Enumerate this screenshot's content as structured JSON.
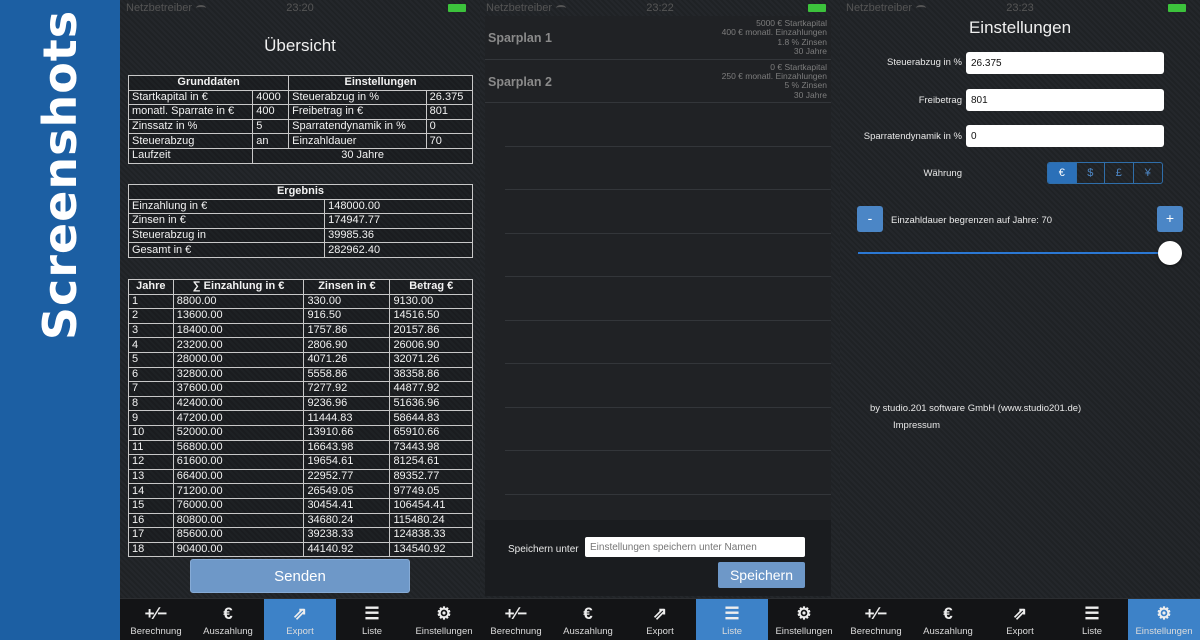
{
  "sidebar": {
    "title": "Screenshots"
  },
  "status": [
    {
      "carrier": "Netzbetreiber",
      "time": "23:20"
    },
    {
      "carrier": "Netzbetreiber",
      "time": "23:22"
    },
    {
      "carrier": "Netzbetreiber",
      "time": "23:23"
    }
  ],
  "overview": {
    "title": "Übersicht",
    "grund_header": "Grunddaten",
    "einst_header": "Einstellungen",
    "rows": [
      {
        "l1": "Startkapital in €",
        "v1": "4000",
        "l2": "Steuerabzug in %",
        "v2": "26.375"
      },
      {
        "l1": "monatl. Sparrate in €",
        "v1": "400",
        "l2": "Freibetrag in €",
        "v2": "801"
      },
      {
        "l1": "Zinssatz in %",
        "v1": "5",
        "l2": "Sparratendynamik in %",
        "v2": "0"
      },
      {
        "l1": "Steuerabzug",
        "v1": "an",
        "l2": "Einzahldauer",
        "v2": "70"
      }
    ],
    "laufzeit_label": "Laufzeit",
    "laufzeit_value": "30 Jahre",
    "ergebnis_header": "Ergebnis",
    "ergebnis": [
      {
        "label": "Einzahlung in €",
        "value": "148000.00"
      },
      {
        "label": "Zinsen in €",
        "value": "174947.77"
      },
      {
        "label": "Steuerabzug in",
        "value": "39985.36"
      },
      {
        "label": "Gesamt in €",
        "value": "282962.40"
      }
    ],
    "years_headers": [
      "Jahre",
      "∑ Einzahlung in €",
      "Zinsen in €",
      "Betrag €"
    ],
    "years": [
      [
        "1",
        "8800.00",
        "330.00",
        "9130.00"
      ],
      [
        "2",
        "13600.00",
        "916.50",
        "14516.50"
      ],
      [
        "3",
        "18400.00",
        "1757.86",
        "20157.86"
      ],
      [
        "4",
        "23200.00",
        "2806.90",
        "26006.90"
      ],
      [
        "5",
        "28000.00",
        "4071.26",
        "32071.26"
      ],
      [
        "6",
        "32800.00",
        "5558.86",
        "38358.86"
      ],
      [
        "7",
        "37600.00",
        "7277.92",
        "44877.92"
      ],
      [
        "8",
        "42400.00",
        "9236.96",
        "51636.96"
      ],
      [
        "9",
        "47200.00",
        "11444.83",
        "58644.83"
      ],
      [
        "10",
        "52000.00",
        "13910.66",
        "65910.66"
      ],
      [
        "11",
        "56800.00",
        "16643.98",
        "73443.98"
      ],
      [
        "12",
        "61600.00",
        "19654.61",
        "81254.61"
      ],
      [
        "13",
        "66400.00",
        "22952.77",
        "89352.77"
      ],
      [
        "14",
        "71200.00",
        "26549.05",
        "97749.05"
      ],
      [
        "15",
        "76000.00",
        "30454.41",
        "106454.41"
      ],
      [
        "16",
        "80800.00",
        "34680.24",
        "115480.24"
      ],
      [
        "17",
        "85600.00",
        "39238.33",
        "124838.33"
      ],
      [
        "18",
        "90400.00",
        "44140.92",
        "134540.92"
      ]
    ],
    "send_button": "Senden"
  },
  "liste": {
    "plans": [
      {
        "name": "Sparplan 1",
        "details": [
          "5000 € Startkapital",
          "400 € monatl. Einzahlungen",
          "1.8 % Zinsen",
          "30 Jahre"
        ]
      },
      {
        "name": "Sparplan 2",
        "details": [
          "0 € Startkapital",
          "250 € monatl. Einzahlungen",
          "5 % Zinsen",
          "30 Jahre"
        ]
      }
    ],
    "save_label": "Speichern unter",
    "save_placeholder": "Einstellungen speichern unter Namen",
    "save_button": "Speichern"
  },
  "settings": {
    "title": "Einstellungen",
    "steuer_label": "Steuerabzug in %",
    "steuer_value": "26.375",
    "freibetrag_label": "Freibetrag",
    "freibetrag_value": "801",
    "dynamik_label": "Sparratendynamik in %",
    "dynamik_value": "0",
    "waehrung_label": "Währung",
    "currencies": [
      "€",
      "$",
      "£",
      "¥"
    ],
    "selected_currency": "€",
    "minus": "-",
    "plus": "+",
    "einzahldauer_label": "Einzahldauer begrenzen auf Jahre: 70",
    "slider_value": 1.0,
    "credit": "by studio.201 software GmbH (www.studio201.de)",
    "impressum": "Impressum"
  },
  "tabbar": {
    "tabs": [
      {
        "icon": "plus-minus-icon",
        "glyph": "+∕−",
        "label": "Berechnung"
      },
      {
        "icon": "euro-icon",
        "glyph": "€",
        "label": "Auszahlung"
      },
      {
        "icon": "share-icon",
        "glyph": "⇗",
        "label": "Export"
      },
      {
        "icon": "list-icon",
        "glyph": "☰",
        "label": "Liste"
      },
      {
        "icon": "gears-icon",
        "glyph": "⚙",
        "label": "Einstellungen"
      }
    ],
    "active_by_screen": [
      "Export",
      "Liste",
      "Einstellungen"
    ]
  },
  "colors": {
    "accent": "#3d82c8",
    "button": "#6e98c8",
    "sidebar": "#1c5fa3"
  }
}
